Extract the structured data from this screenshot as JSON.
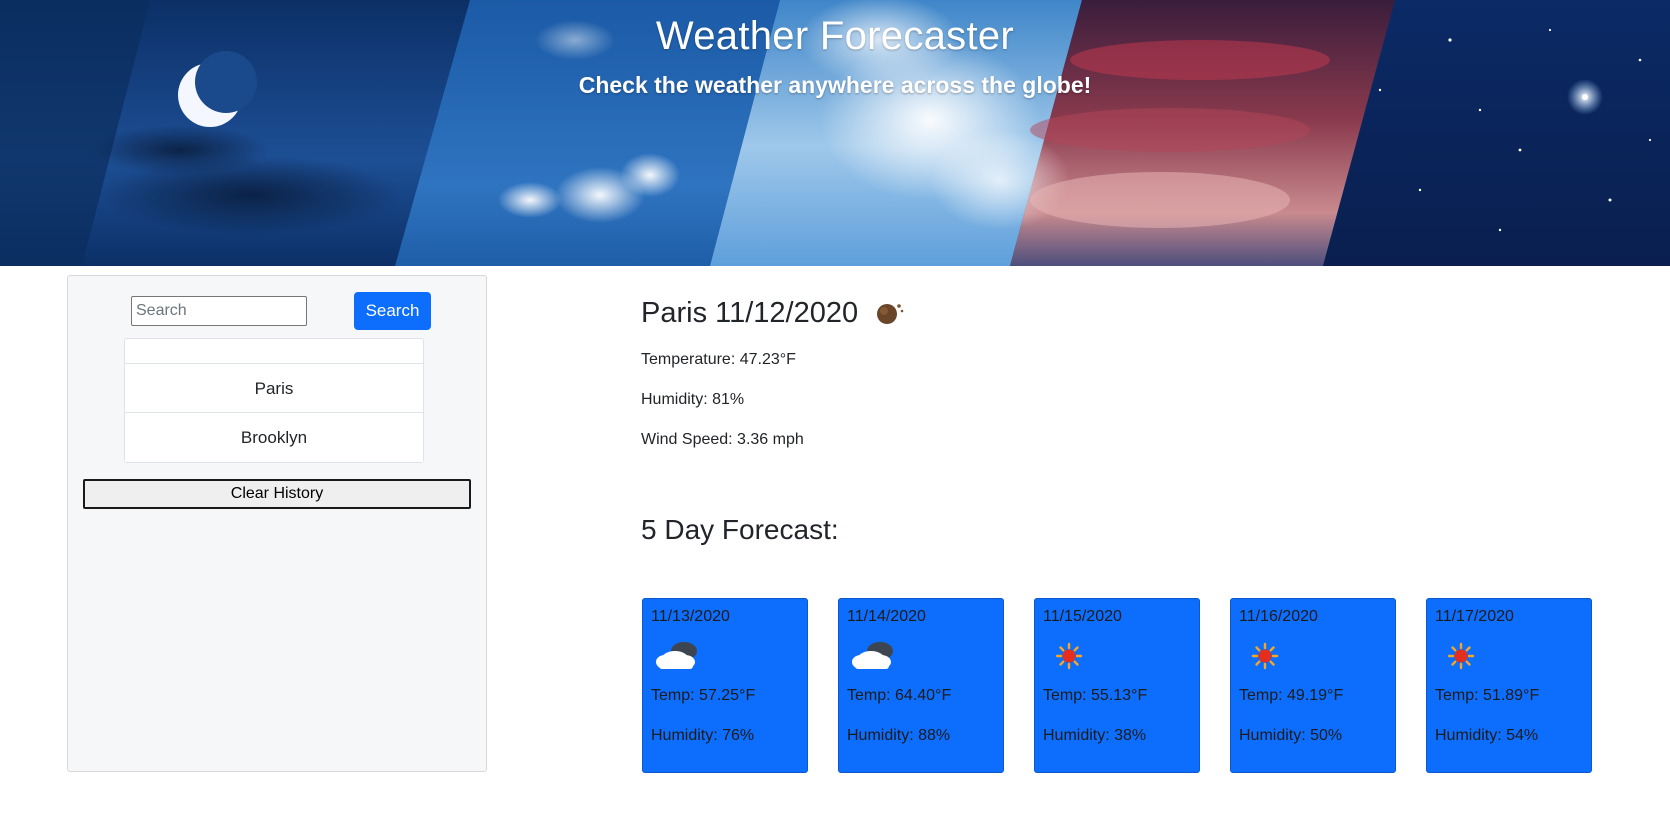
{
  "header": {
    "title": "Weather Forecaster",
    "subtitle": "Check the weather anywhere across the globe!"
  },
  "sidebar": {
    "search": {
      "placeholder": "Search",
      "value": "",
      "button_label": "Search"
    },
    "history": [
      "Paris",
      "Brooklyn"
    ],
    "clear_label": "Clear History"
  },
  "current": {
    "city": "Paris",
    "date": "11/12/2020",
    "icon": "night-clear-icon",
    "temperature": "Temperature: 47.23°F",
    "humidity": "Humidity: 81%",
    "wind": "Wind Speed: 3.36 mph"
  },
  "forecast": {
    "heading": "5 Day Forecast:",
    "days": [
      {
        "date": "11/13/2020",
        "icon": "cloudy-icon",
        "temp": "Temp: 57.25°F",
        "humidity": "Humidity: 76%"
      },
      {
        "date": "11/14/2020",
        "icon": "cloudy-icon",
        "temp": "Temp: 64.40°F",
        "humidity": "Humidity: 88%"
      },
      {
        "date": "11/15/2020",
        "icon": "sun-icon",
        "temp": "Temp: 55.13°F",
        "humidity": "Humidity: 38%"
      },
      {
        "date": "11/16/2020",
        "icon": "sun-icon",
        "temp": "Temp: 49.19°F",
        "humidity": "Humidity: 50%"
      },
      {
        "date": "11/17/2020",
        "icon": "sun-icon",
        "temp": "Temp: 51.89°F",
        "humidity": "Humidity: 54%"
      }
    ]
  },
  "colors": {
    "accent": "#0d6efd",
    "card_bg": "#0d6efd",
    "sidebar_bg": "#f6f7f9"
  }
}
